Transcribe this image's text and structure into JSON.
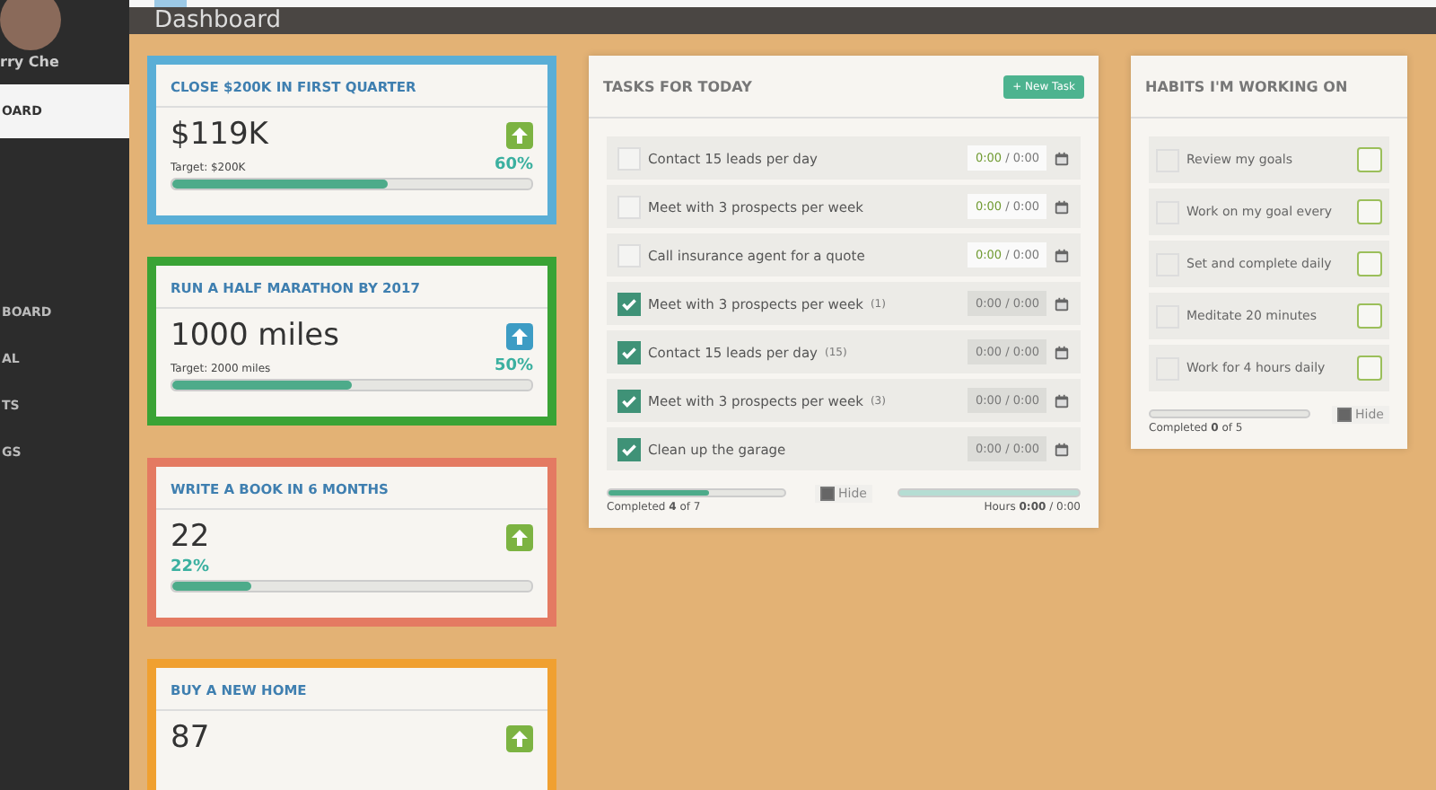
{
  "sidebar": {
    "user_name": "rry Che",
    "items": [
      {
        "label": "OARD",
        "selected": true
      },
      {
        "label": "BOARD",
        "selected": false
      },
      {
        "label": "AL",
        "selected": false
      },
      {
        "label": "TS",
        "selected": false
      },
      {
        "label": "GS",
        "selected": false
      }
    ]
  },
  "header": {
    "title": "Dashboard"
  },
  "goals": [
    {
      "title": "CLOSE $200K IN FIRST QUARTER",
      "value": "$119K",
      "target": "Target: $200K",
      "percent": "60%",
      "level": 0.6,
      "color": "#5aaed6",
      "icon": {
        "color": "#7cb342"
      }
    },
    {
      "title": "RUN A HALF MARATHON BY 2017",
      "value": "1000 miles",
      "target": "Target: 2000 miles",
      "percent": "50%",
      "level": 0.5,
      "color": "#3aa335",
      "icon": {
        "color": "#3d9cc4"
      }
    },
    {
      "title": "WRITE A BOOK IN 6 MONTHS",
      "value": "22",
      "percent": "22%",
      "level": 0.22,
      "color": "#e47a62",
      "icon": {
        "color": "#7cb342"
      }
    },
    {
      "title": "BUY A NEW HOME",
      "value": "87",
      "color": "#f0a030",
      "icon": {
        "color": "#7cb342"
      }
    }
  ],
  "tasks": {
    "title": "TASKS FOR TODAY",
    "new_button": "+ New Task",
    "items": [
      {
        "text": "Contact 15 leads per day",
        "checked": false,
        "time_done": "0:00",
        "time_total": "/ 0:00"
      },
      {
        "text": "Meet with 3 prospects per week",
        "checked": false,
        "time_done": "0:00",
        "time_total": "/ 0:00"
      },
      {
        "text": "Call insurance agent for a quote",
        "checked": false,
        "time_done": "0:00",
        "time_total": "/ 0:00"
      },
      {
        "text": "Meet with 3 prospects per week",
        "count": "(1)",
        "checked": true,
        "time_done": "0:00",
        "time_total": "/ 0:00"
      },
      {
        "text": "Contact 15 leads per day",
        "count": "(15)",
        "checked": true,
        "time_done": "0:00",
        "time_total": "/ 0:00"
      },
      {
        "text": "Meet with 3 prospects per week",
        "count": "(3)",
        "checked": true,
        "time_done": "0:00",
        "time_total": "/ 0:00"
      },
      {
        "text": "Clean up the garage",
        "checked": true,
        "time_done": "0:00",
        "time_total": "/ 0:00"
      }
    ],
    "completed": {
      "text": "Completed **4** of 7",
      "level": 0.57
    },
    "hide": {
      "label": "Hide",
      "checked": true
    },
    "hours": {
      "text": "Hours **0:00** / 0:00"
    }
  },
  "habits": {
    "title": "HABITS I'M WORKING ON",
    "items": [
      {
        "text": "Review my goals",
        "checked": false
      },
      {
        "text": "Work on my goal every",
        "checked": false
      },
      {
        "text": "Set and complete daily",
        "checked": false
      },
      {
        "text": "Meditate 20 minutes",
        "checked": false
      },
      {
        "text": "Work for 4 hours daily",
        "checked": false
      }
    ],
    "completed": {
      "text": "Completed **0** of 5",
      "level": 0
    },
    "hide": {
      "label": "Hide",
      "checked": true
    }
  }
}
